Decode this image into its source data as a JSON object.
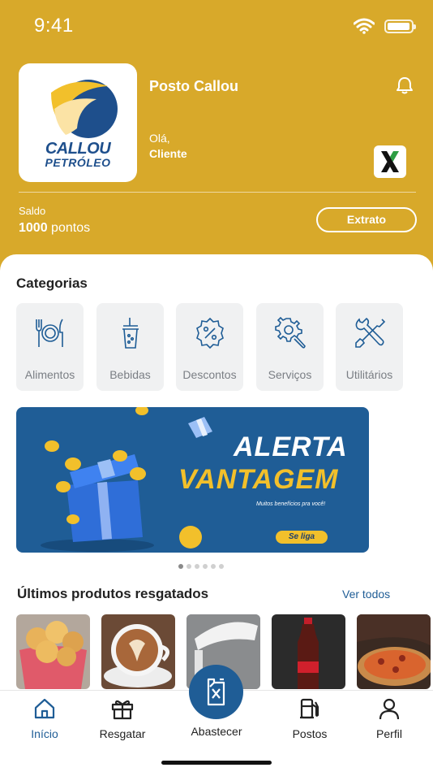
{
  "status_bar": {
    "time": "9:41"
  },
  "header": {
    "logo": {
      "line1": "CALLOU",
      "line2": "PETRÓLEO"
    },
    "station_name": "Posto Callou",
    "greeting": "Olá,",
    "client_name": "Cliente",
    "balance_label": "Saldo",
    "balance_points": "1000",
    "balance_unit": "pontos",
    "extract_button": "Extrato",
    "colors": {
      "background": "#D8A92A",
      "accent": "#1F5D96"
    }
  },
  "categories": {
    "title": "Categorias",
    "items": [
      {
        "label": "Alimentos",
        "icon": "utensils-plate-icon"
      },
      {
        "label": "Bebidas",
        "icon": "drink-cup-icon"
      },
      {
        "label": "Descontos",
        "icon": "percent-badge-icon"
      },
      {
        "label": "Serviços",
        "icon": "gear-wrench-icon"
      },
      {
        "label": "Utilitários",
        "icon": "wrench-screwdriver-icon"
      }
    ]
  },
  "banner": {
    "line1": "ALERTA",
    "line2": "VANTAGEM",
    "subtitle": "Muitos benefícios pra você!",
    "button": "Se liga",
    "slide_count": 6,
    "active_slide": 1
  },
  "recent_products": {
    "title": "Últimos produtos resgatados",
    "see_all": "Ver todos",
    "items": [
      {
        "image": "cheese-bread-bowl"
      },
      {
        "image": "latte-cup"
      },
      {
        "image": "shower-head"
      },
      {
        "image": "cola-bottle"
      },
      {
        "image": "pizza"
      }
    ]
  },
  "tabbar": {
    "tabs": [
      {
        "label": "Início",
        "icon": "home-icon",
        "active": true
      },
      {
        "label": "Resgatar",
        "icon": "gift-icon",
        "active": false
      },
      {
        "label": "Postos",
        "icon": "fuel-pump-icon",
        "active": false
      },
      {
        "label": "Perfil",
        "icon": "user-icon",
        "active": false
      }
    ],
    "center_action": {
      "label": "Abastecer",
      "icon": "fuel-can-icon"
    }
  }
}
